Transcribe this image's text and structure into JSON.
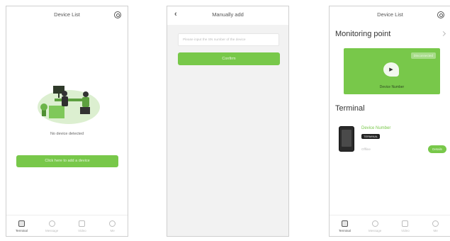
{
  "screen1": {
    "title": "Device List",
    "empty_text": "No device detected",
    "add_button": "Click here to add a device"
  },
  "screen2": {
    "title": "Manually add",
    "input_placeholder": "Please input the SN number of the device",
    "confirm_button": "Confirm"
  },
  "screen3": {
    "title": "Device List",
    "monitoring_title": "Monitoring point",
    "monitoring_status": "Disconnected",
    "monitoring_device_number": "Device Number",
    "terminal_title": "Terminal",
    "device_name": "Device Number",
    "device_badge": "TERMINAL",
    "device_status": "Offline",
    "details_button": "Details"
  },
  "tabs": [
    "Terminal",
    "Message",
    "Video",
    "Me"
  ],
  "colors": {
    "accent": "#78c84a",
    "border": "#cfcfcf"
  }
}
